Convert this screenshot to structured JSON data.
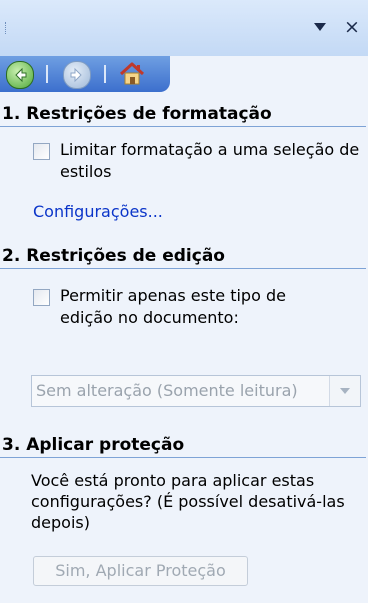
{
  "window": {
    "menu_icon": "dropdown-arrow-icon",
    "close_glyph": "×"
  },
  "nav": {
    "back_icon": "back-arrow-icon",
    "forward_icon": "forward-arrow-icon",
    "home_icon": "home-icon"
  },
  "sections": {
    "formatting": {
      "title": "1. Restrições de formatação",
      "checkbox_label": "Limitar formatação a uma seleção de estilos",
      "checked": false,
      "settings_link": "Configurações..."
    },
    "editing": {
      "title": "2. Restrições de edição",
      "checkbox_label": "Permitir apenas este tipo de edição no documento:",
      "checked": false,
      "select_value": "Sem alteração (Somente leitura)"
    },
    "protection": {
      "title": "3. Aplicar proteção",
      "description": "Você está pronto para aplicar estas configurações? (É possível desativá-las depois)",
      "button_label": "Sim, Aplicar Proteção"
    }
  },
  "colors": {
    "pane_bg": "#eef3fb",
    "nav_bar": "#4a7bd6",
    "link": "#0b35c9",
    "disabled_text": "#9aa3ad"
  }
}
